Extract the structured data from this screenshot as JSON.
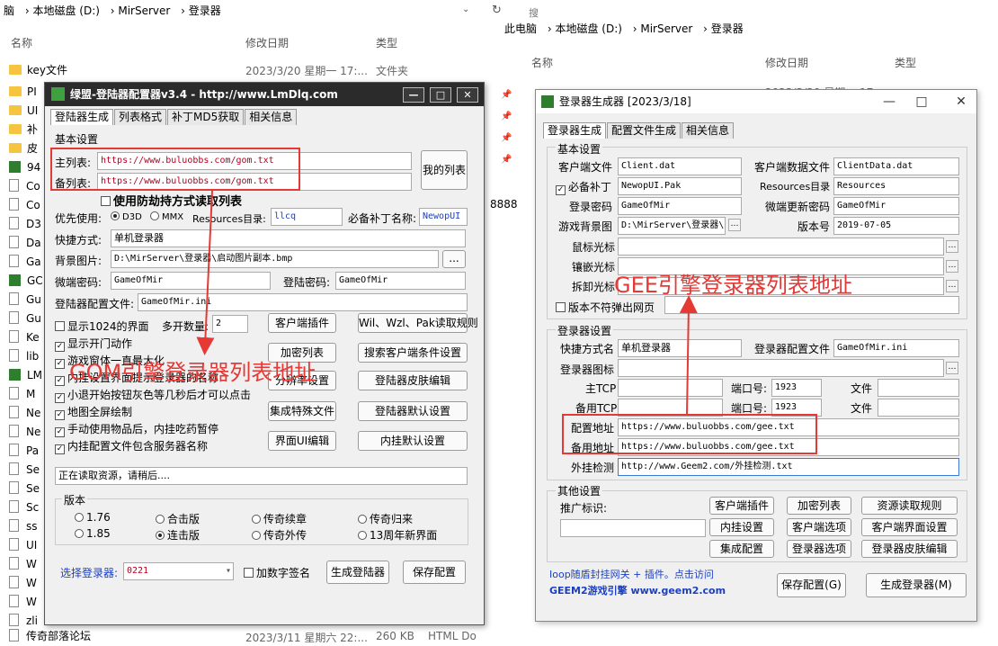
{
  "explorer_left": {
    "breadcrumb": [
      "脑",
      "本地磁盘 (D:)",
      "MirServer",
      "登录器"
    ],
    "columns": {
      "name": "名称",
      "modified": "修改日期",
      "type": "类型"
    },
    "row0": {
      "name": "key文件",
      "date": "2023/3/20 星期一 17:...",
      "type": "文件夹"
    },
    "rows": [
      "PI",
      "UI",
      "补",
      "皮",
      "94",
      "Co",
      "Co",
      "D3",
      "Da",
      "Ga",
      "GC",
      "Gu",
      "Gu",
      "Ke",
      "lib",
      "LM",
      "M",
      "Ne",
      "Ne",
      "Pa",
      "Se",
      "Se",
      "Sc",
      "ss",
      "UI",
      "W",
      "W",
      "W",
      "zli"
    ],
    "bottom": "传奇部落论坛",
    "bottom_date": "2023/3/11 星期六 22:...",
    "bottom_size": "260 KB",
    "bottom_type": "HTML Do"
  },
  "middle": {
    "refresh": "↻",
    "search": "搜",
    "number": "8888"
  },
  "explorer_right": {
    "breadcrumb": [
      "此电脑",
      "本地磁盘 (D:)",
      "MirServer",
      "登录器"
    ],
    "columns": {
      "name": "名称",
      "modified": "修改日期",
      "type": "类型"
    },
    "partial_row": "2023/3/20 星期一 17:..."
  },
  "win1": {
    "title": "绿盟-登陆器配置器v3.4 - http://www.LmDlq.com",
    "tabs": [
      "登陆器生成",
      "列表格式",
      "补丁MD5获取",
      "相关信息"
    ],
    "group_basic": "基本设置",
    "main_list_label": "主列表:",
    "main_list_value": "https://www.buluobbs.com/gom.txt",
    "backup_list_label": "备列表:",
    "backup_list_value": "https://www.buluobbs.com/gom.txt",
    "my_list_button": "我的列表",
    "anti_hijack": "使用防劫持方式读取列表",
    "priority_label": "优先使用:",
    "d3d": "D3D",
    "mmx": "MMX",
    "resources_label": "Resources目录:",
    "resources_value": "llcq",
    "patch_label": "必备补丁名称:",
    "patch_value": "NewopUI",
    "shortcut_label": "快捷方式:",
    "shortcut_value": "单机登录器",
    "bg_label": "背景图片:",
    "bg_value": "D:\\MirServer\\登录器\\启动图片副本.bmp",
    "browse": "...",
    "gamepw_label": "微端密码:",
    "gamepw_value": "GameOfMir",
    "loginpw_label": "登陆密码:",
    "loginpw_value": "GameOfMir",
    "cfgfile_label": "登陆器配置文件:",
    "cfgfile_value": "GameOfMir.ini",
    "checks": [
      "显示1024的界面",
      "显示开门动作",
      "游戏窗体一直最大化",
      "内挂设置界面提示登录器的名称",
      "小退开始按钮灰色等几秒后才可以点击",
      "地图全屏绘制",
      "手动使用物品后，内挂吃药暂停",
      "内挂配置文件包含服务器名称"
    ],
    "multi_label": "多开数量:",
    "multi_value": "2",
    "buttons": [
      "客户端插件",
      "Wil、Wzl、Pak读取规则",
      "加密列表",
      "搜索客户端条件设置",
      "分辨率设置",
      "登陆器皮肤编辑",
      "集成特殊文件",
      "登陆器默认设置",
      "界面UI编辑",
      "内挂默认设置"
    ],
    "status": "正在读取资源，请稍后....",
    "version_label": "版本",
    "versions": [
      "1.76",
      "合击版",
      "传奇续章",
      "传奇归来",
      "1.85",
      "连击版",
      "传奇外传",
      "13周年新界面"
    ],
    "select_label": "选择登录器:",
    "select_value": "0221",
    "sign_label": "加数字签名",
    "gen_button": "生成登陆器",
    "save_button": "保存配置"
  },
  "win2": {
    "title": "登录器生成器 [2023/3/18]",
    "tabs": [
      "登录器生成",
      "配置文件生成",
      "相关信息"
    ],
    "group_basic": "基本设置",
    "client_file_label": "客户端文件",
    "client_file_value": "Client.dat",
    "client_data_label": "客户端数据文件",
    "client_data_value": "ClientData.dat",
    "patch_label": "必备补丁",
    "patch_value": "NewopUI.Pak",
    "res_label": "Resources目录",
    "res_value": "Resources",
    "loginpw_label": "登录密码",
    "loginpw_value": "GameOfMir",
    "micropw_label": "微端更新密码",
    "micropw_value": "GameOfMir",
    "bg_label": "游戏背景图",
    "bg_value": "D:\\MirServer\\登录器\\",
    "version_label": "版本号",
    "version_value": "2019-07-05",
    "cursor_label": "鼠标光标",
    "embed_label": "镶嵌光标",
    "disasm_label": "拆卸光标",
    "mismatch_label": "版本不符弹出网页",
    "group_launcher": "登录器设置",
    "shortcut_label": "快捷方式名",
    "shortcut_value": "单机登录器",
    "cfg_label": "登录器配置文件",
    "cfg_value": "GameOfMir.ini",
    "icon_label": "登录器图标",
    "main_tcp": "主TCP",
    "backup_tcp": "备用TCP",
    "port_label": "端口号:",
    "port1": "1923",
    "port2": "1923",
    "file_label": "文件",
    "cfg_addr_label": "配置地址",
    "cfg_addr_value": "https://www.buluobbs.com/gee.txt",
    "backup_addr_label": "备用地址",
    "backup_addr_value": "https://www.buluobbs.com/gee.txt",
    "plugin_check_label": "外挂检测",
    "plugin_check_value": "http://www.Geem2.com/外挂检测.txt",
    "group_other": "其他设置",
    "promo_label": "推广标识:",
    "buttons": [
      "客户端插件",
      "加密列表",
      "资源读取规则",
      "内挂设置",
      "客户端选项",
      "客户端界面设置",
      "集成配置",
      "登录器选项",
      "登录器皮肤编辑"
    ],
    "footer1": "Ioop随盾封挂网关 + 插件。点击访问",
    "footer2": "GEEM2游戏引擎  www.geem2.com",
    "save_button": "保存配置(G)",
    "gen_button": "生成登录器(M)"
  },
  "annotations": {
    "left": "GOM引擎登录器列表地址",
    "right": "GEE引擎登录器列表地址"
  },
  "colors": {
    "annotation": "#e53935",
    "title_dark": "#2b2b2b"
  }
}
